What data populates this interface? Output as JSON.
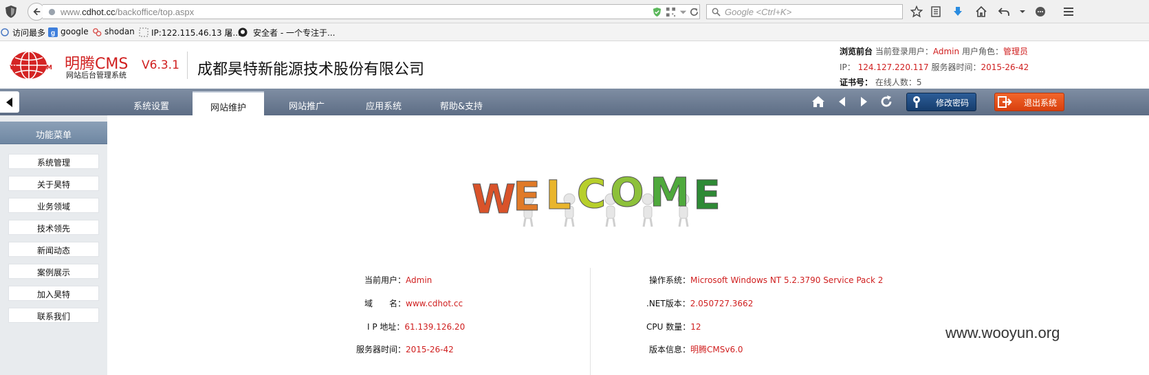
{
  "browser": {
    "url_prefix": "www.",
    "url_host": "cdhot.cc",
    "url_path": "/backoffice/top.aspx",
    "search_placeholder": "Google <Ctrl+K>",
    "bookmarks": [
      {
        "label": "访问最多",
        "icon": "bookmark-star-icon"
      },
      {
        "label": "google",
        "icon": "google-icon"
      },
      {
        "label": "shodan",
        "icon": "shodan-icon"
      },
      {
        "label": "IP:122.115.46.13 屠...",
        "icon": "dashed-page-icon"
      },
      {
        "label": "安全者 - 一个专注于...",
        "icon": "github-icon"
      }
    ]
  },
  "header": {
    "brand_name": "明腾CMS",
    "brand_sub": "网站后台管理系统",
    "version": "V6.3.1",
    "company": "成都昊特新能源技术股份有限公司",
    "info": {
      "browse_front": "浏览前台",
      "current_user_label": "当前登录用户：",
      "current_user": "Admin",
      "role_label": "用户角色：",
      "role": "管理员",
      "ip_label": "IP：",
      "ip": "124.127.220.117",
      "server_time_label": "服务器时间：",
      "server_time": "2015-26-42",
      "cert_label": "证书号：",
      "online_label": "在线人数：",
      "online": "5"
    }
  },
  "nav": {
    "tabs": [
      "系统设置",
      "网站维护",
      "网站推广",
      "应用系统",
      "帮助&支持"
    ],
    "active_tab": "网站维护",
    "change_password": "修改密码",
    "logout": "退出系统"
  },
  "sidebar": {
    "title": "功能菜单",
    "items": [
      "系统管理",
      "关于昊特",
      "业务领域",
      "技术领先",
      "新闻动态",
      "案例展示",
      "加入昊特",
      "联系我们"
    ]
  },
  "main": {
    "welcome_letters": [
      "W",
      "E",
      "L",
      "C",
      "O",
      "M",
      "E"
    ],
    "left": [
      {
        "label": "当前用户：",
        "value": "Admin"
      },
      {
        "label": "域　　名：",
        "value": "www.cdhot.cc"
      },
      {
        "label": "I P 地址：",
        "value": "61.139.126.20"
      },
      {
        "label": "服务器时间：",
        "value": "2015-26-42"
      }
    ],
    "right": [
      {
        "label": "操作系统：",
        "value": "Microsoft Windows NT 5.2.3790 Service Pack 2"
      },
      {
        "label": ".NET版本：",
        "value": "2.050727.3662"
      },
      {
        "label": "CPU 数量：",
        "value": "12"
      },
      {
        "label": "版本信息：",
        "value": "明腾CMSv6.0"
      }
    ]
  },
  "watermark": "www.wooyun.org",
  "colors": {
    "accent_red": "#d02020",
    "nav_blue": "#6b7b93",
    "welcome": [
      "#d9532a",
      "#e07a28",
      "#e9b52c",
      "#b7cf2b",
      "#8dc13a",
      "#4fa93c",
      "#2e8a35"
    ]
  }
}
